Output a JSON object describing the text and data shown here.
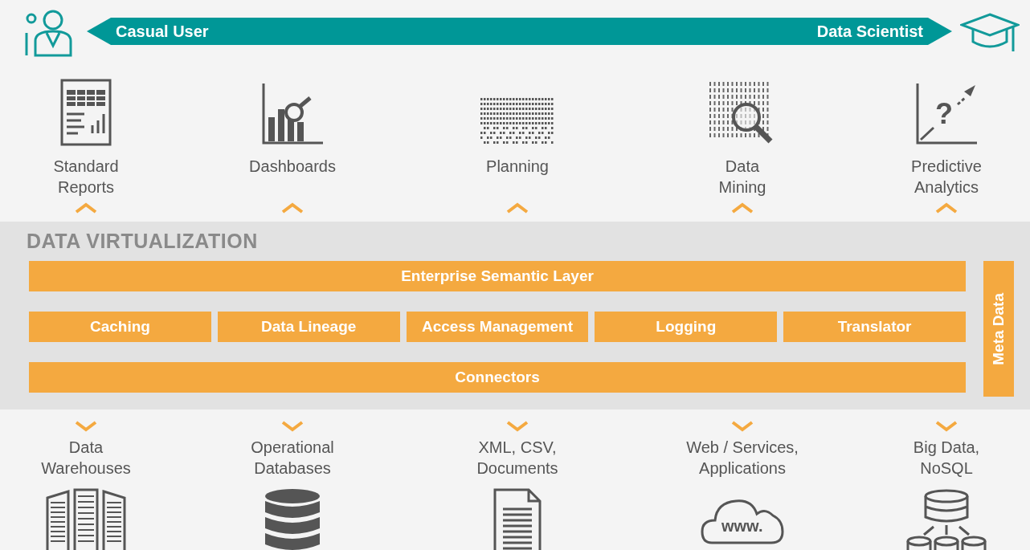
{
  "banner": {
    "left_label": "Casual User",
    "right_label": "Data Scientist"
  },
  "consumers": [
    {
      "kind": "reports",
      "label": [
        "Standard",
        "Reports"
      ]
    },
    {
      "kind": "dashboard",
      "label": [
        "Dashboards"
      ]
    },
    {
      "kind": "planning",
      "label": [
        "Planning"
      ]
    },
    {
      "kind": "mining",
      "label": [
        "Data",
        "Mining"
      ]
    },
    {
      "kind": "predictive",
      "glyph": "?",
      "label": [
        "Predictive",
        "Analytics"
      ]
    }
  ],
  "platform": {
    "title": "DATA VIRTUALIZATION",
    "semantic_layer": "Enterprise Semantic Layer",
    "services": [
      "Caching",
      "Data Lineage",
      "Access Management",
      "Logging",
      "Translator"
    ],
    "connectors": "Connectors",
    "meta_data": "Meta Data"
  },
  "sources": [
    {
      "kind": "warehouse",
      "label": [
        "Data",
        "Warehouses"
      ]
    },
    {
      "kind": "database",
      "label": [
        "Operational",
        "Databases"
      ]
    },
    {
      "kind": "document",
      "label": [
        "XML, CSV,",
        "Documents"
      ]
    },
    {
      "kind": "web",
      "glyph": "www.",
      "label": [
        "Web / Services,",
        "Applications"
      ]
    },
    {
      "kind": "bigdata",
      "label": [
        "Big Data,",
        "NoSQL"
      ]
    }
  ]
}
